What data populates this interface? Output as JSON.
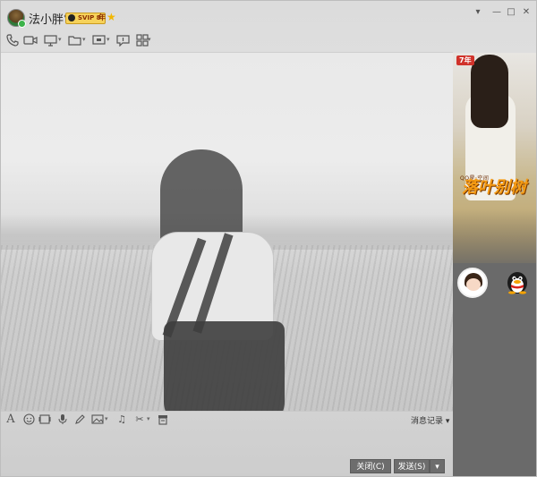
{
  "title_bar": {
    "nickname": "法小胖°",
    "vip_badge": "SVIP 8",
    "year_label": "年",
    "minimize_glyph": "—",
    "restore_glyph": "□",
    "close_glyph": "✕",
    "dropdown_glyph": "▾"
  },
  "top_toolbar": {
    "icons": [
      "phone-icon",
      "video-icon",
      "screen-share-icon",
      "folder-icon",
      "remote-desktop-icon",
      "chat-bubble-icon",
      "apps-grid-icon"
    ]
  },
  "input_toolbar": {
    "icons": [
      "font-icon",
      "emoji-icon",
      "gif-icon",
      "voice-icon",
      "pen-icon",
      "image-icon",
      "music-icon",
      "scissors-icon",
      "stamp-icon"
    ],
    "history_label": "消息记录"
  },
  "actions": {
    "close_label": "关闭(C)",
    "send_label": "发送(S)",
    "send_menu_glyph": "▾"
  },
  "sidebar": {
    "ad_tag": "7年",
    "ad_subtitle": "QQ星·空间",
    "ad_title": "落叶别树"
  },
  "colors": {
    "send_button": "#6d6d6d",
    "vip_gold": "#f6d25a",
    "ad_title": "#f59a12"
  }
}
